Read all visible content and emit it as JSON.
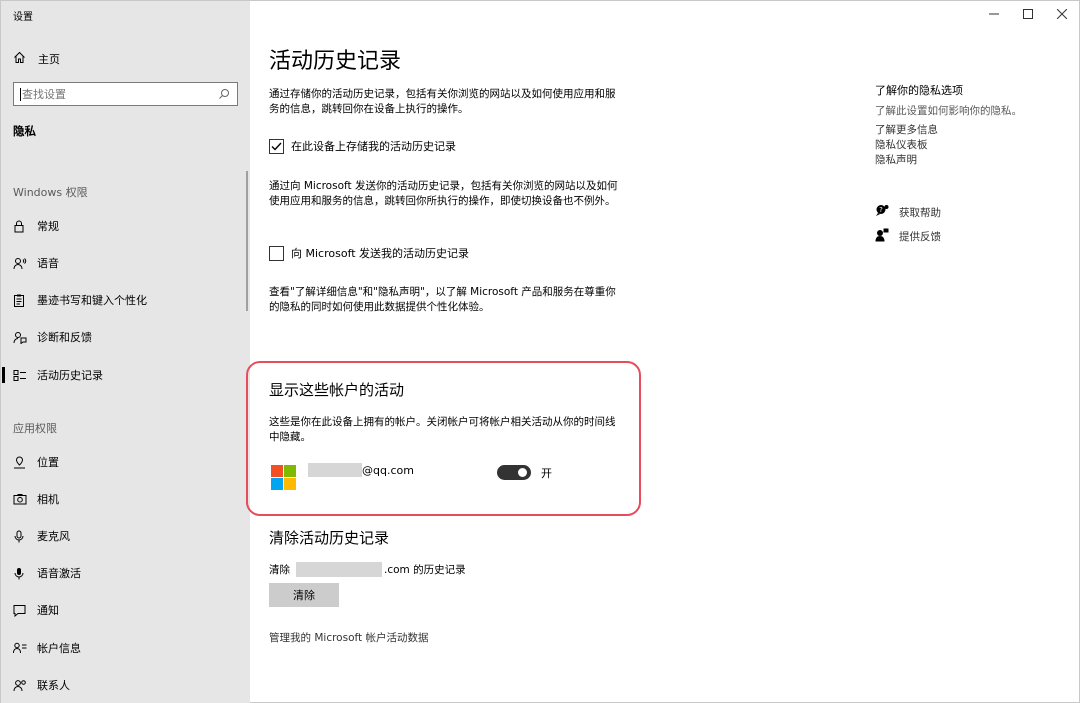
{
  "app": {
    "title": "设置"
  },
  "sidebar": {
    "home": "主页",
    "search_placeholder": "查找设置",
    "section": "隐私",
    "windows_group": "Windows 权限",
    "windows_items": [
      {
        "label": "常规",
        "icon": "lock-icon"
      },
      {
        "label": "语音",
        "icon": "speech-icon"
      },
      {
        "label": "墨迹书写和键入个性化",
        "icon": "clipboard-icon"
      },
      {
        "label": "诊断和反馈",
        "icon": "feedback-icon"
      },
      {
        "label": "活动历史记录",
        "icon": "activity-icon",
        "active": true
      }
    ],
    "app_group": "应用权限",
    "app_items": [
      {
        "label": "位置",
        "icon": "location-icon"
      },
      {
        "label": "相机",
        "icon": "camera-icon"
      },
      {
        "label": "麦克风",
        "icon": "microphone-icon"
      },
      {
        "label": "语音激活",
        "icon": "voice-activation-icon"
      },
      {
        "label": "通知",
        "icon": "notification-icon"
      },
      {
        "label": "帐户信息",
        "icon": "account-info-icon"
      },
      {
        "label": "联系人",
        "icon": "contacts-icon"
      }
    ]
  },
  "main": {
    "title": "活动历史记录",
    "para1": "通过存储你的活动历史记录，包括有关你浏览的网站以及如何使用应用和服务的信息，跳转回你在设备上执行的操作。",
    "checkbox1": {
      "label": "在此设备上存储我的活动历史记录",
      "checked": true
    },
    "para2": "通过向 Microsoft 发送你的活动历史记录，包括有关你浏览的网站以及如何使用应用和服务的信息，跳转回你所执行的操作，即使切换设备也不例外。",
    "checkbox2": {
      "label": "向 Microsoft 发送我的活动历史记录",
      "checked": false
    },
    "para3": "查看\"了解详细信息\"和\"隐私声明\"，以了解 Microsoft 产品和服务在尊重你的隐私的同时如何使用此数据提供个性化体验。",
    "accounts_title": "显示这些帐户的活动",
    "accounts_desc": "这些是你在此设备上拥有的帐户。关闭帐户可将帐户相关活动从你的时间线中隐藏。",
    "account_email_suffix": "@qq.com",
    "toggle_state": "开",
    "clear_title": "清除活动历史记录",
    "clear_prefix": "清除",
    "clear_suffix": ".com 的历史记录",
    "clear_button": "清除",
    "manage_link": "管理我的 Microsoft 帐户活动数据"
  },
  "right_panel": {
    "title": "了解你的隐私选项",
    "subtitle": "了解此设置如何影响你的隐私。",
    "links": [
      "了解更多信息",
      "隐私仪表板",
      "隐私声明"
    ],
    "help": "获取帮助",
    "feedback": "提供反馈"
  },
  "colors": {
    "sidebar_bg": "#e6e6e6",
    "highlight": "#e84b5a",
    "ms_red": "#f25022",
    "ms_green": "#7fba00",
    "ms_blue": "#00a4ef",
    "ms_yellow": "#ffb900"
  }
}
